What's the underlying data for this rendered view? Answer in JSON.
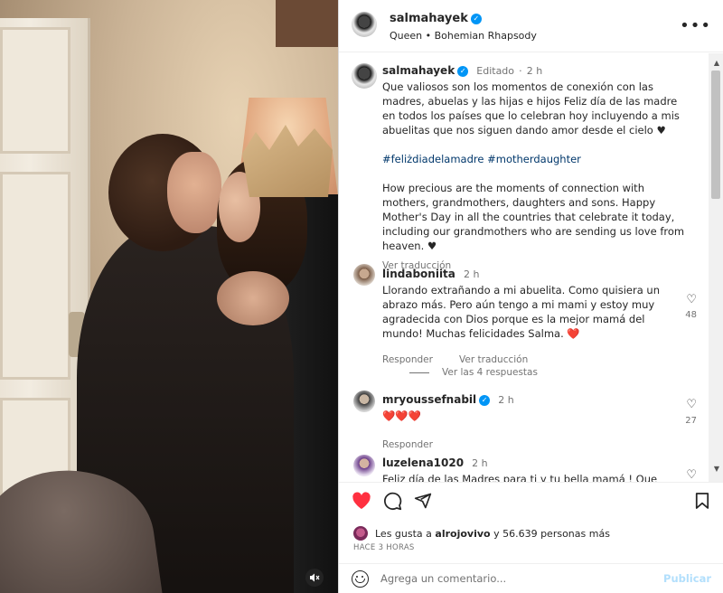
{
  "post": {
    "username": "salmahayek",
    "audio": "Queen • Bohemian Rhapsody",
    "more_icon": "more-horizontal-icon"
  },
  "caption": {
    "username": "salmahayek",
    "edited": "Editado",
    "dot": "·",
    "time": "2 h",
    "text_es": "Que valiosos son los momentos de conexión con las madres, abuelas y las hijas e hijos Feliz día de las madre en todos los países que lo celebran hoy incluyendo a mis abuelitas que nos siguen dando amor desde el cielo ♥",
    "hashtags": "#feliżdiadelamadre #motherdaughter",
    "text_en": "How precious are the moments of connection with mothers, grandmothers, daughters and sons. Happy Mother's Day in all the countries that celebrate it today, including our grandmothers who are sending us love from heaven. ♥",
    "translate": "Ver traducción"
  },
  "comments": [
    {
      "username": "lindaboniita",
      "time": "2 h",
      "text": "Llorando extrañando a mi abuelita. Como quisiera un abrazo más. Pero aún tengo a mi mami y estoy muy agradecida con Dios porque es la mejor mamá del mundo! Muchas felicidades Salma. ❤️",
      "reply": "Responder",
      "translate": "Ver traducción",
      "likes": "48",
      "view_replies": "Ver las 4 respuestas"
    },
    {
      "username": "mryoussefnabil",
      "time": "2 h",
      "text": "❤️❤️❤️",
      "reply": "Responder",
      "likes": "27"
    },
    {
      "username": "luzelena1020",
      "time": "2 h",
      "text": "Feliz día de las Madres para ti y tu bella mamá ! Que"
    }
  ],
  "actions": {
    "likes_prefix": "Les gusta a",
    "likes_user": "alrojovivo",
    "likes_suffix": "y 56.639 personas más",
    "time_ago": "HACE 3 HORAS",
    "comment_placeholder": "Agrega un comentario...",
    "publish": "Publicar"
  },
  "colors": {
    "like_red": "#ff3040",
    "verified_blue": "#0095f6",
    "publish_disabled": "#b2dffc",
    "text": "#262626",
    "muted": "#737373"
  }
}
